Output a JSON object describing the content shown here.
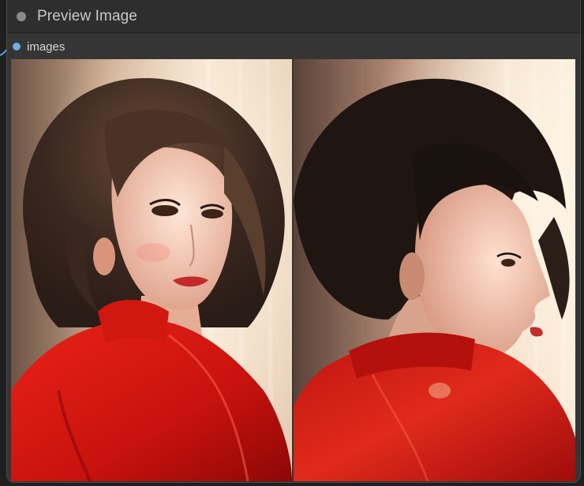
{
  "node": {
    "title": "Preview Image",
    "input_label": "images"
  },
  "images": [
    {
      "subject": "woman-portrait-front",
      "description_icon": "image-icon"
    },
    {
      "subject": "woman-portrait-profile",
      "description_icon": "image-icon"
    }
  ],
  "colors": {
    "canvas": "#1f1f1f",
    "node_body": "#353535",
    "node_title": "#2e2e2e",
    "slot_dot": "#6aaee8",
    "wire": "#5a9bd8"
  }
}
